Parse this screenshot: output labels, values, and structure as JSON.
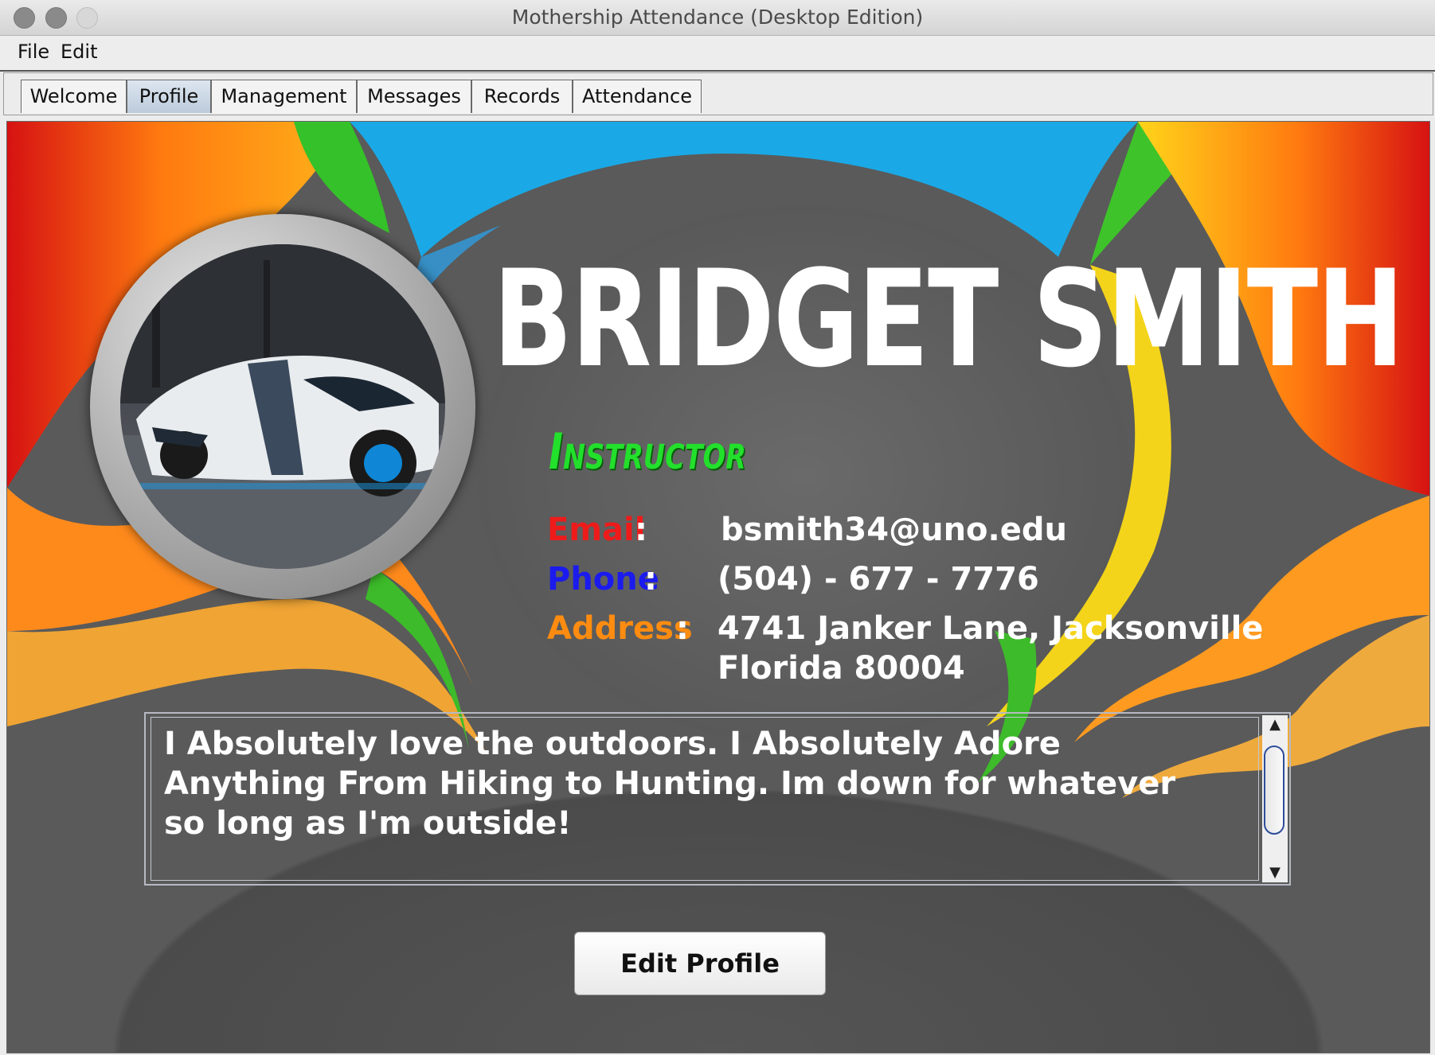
{
  "window": {
    "title": "Mothership Attendance (Desktop Edition)"
  },
  "menu": {
    "items": [
      "File",
      "Edit"
    ]
  },
  "tabs": [
    {
      "label": "Welcome",
      "active": false
    },
    {
      "label": "Profile",
      "active": true
    },
    {
      "label": "Management",
      "active": false
    },
    {
      "label": "Messages",
      "active": false
    },
    {
      "label": "Records",
      "active": false
    },
    {
      "label": "Attendance",
      "active": false
    }
  ],
  "profile": {
    "name": "BRIDGET SMITH",
    "role": "Instructor",
    "email_label": "Email",
    "email": "bsmith34@uno.edu",
    "phone_label": "Phone",
    "phone": "(504) - 677 - 7776",
    "address_label": "Address",
    "address_line1": "4741 Janker Lane, Jacksonville",
    "address_line2": "Florida 80004",
    "colon": ":",
    "bio": "I Absolutely love the outdoors. I Absolutely Adore Anything From Hiking to Hunting. Im down for whatever so long as I'm outside!"
  },
  "scroll": {
    "up_icon": "▲",
    "down_icon": "▼"
  },
  "edit_button": "Edit Profile",
  "colors": {
    "email_label": "#ee1b1b",
    "phone_label": "#1b1bee",
    "address_label": "#ff8c10",
    "role": "#22e02b"
  },
  "icons": {
    "avatar": "sports-car-photo"
  }
}
